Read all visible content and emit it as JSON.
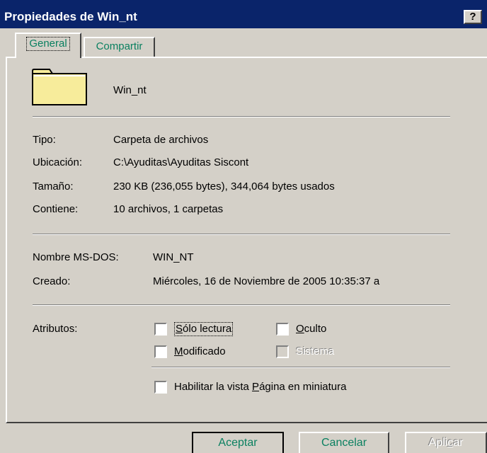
{
  "window": {
    "title": "Propiedades de Win_nt",
    "help_label": "?"
  },
  "tabs": [
    {
      "label": "General",
      "active": true
    },
    {
      "label": "Compartir",
      "active": false
    }
  ],
  "folder": {
    "name": "Win_nt",
    "icon": "folder-icon"
  },
  "info": {
    "tipo_label": "Tipo:",
    "tipo_value": "Carpeta de archivos",
    "ubicacion_label": "Ubicación:",
    "ubicacion_value": "C:\\Ayuditas\\Ayuditas Siscont",
    "tamano_label": "Tamaño:",
    "tamano_value": "230 KB (236,055 bytes), 344,064 bytes usados",
    "contiene_label": "Contiene:",
    "contiene_value": "10 archivos, 1 carpetas",
    "msdos_label": "Nombre MS-DOS:",
    "msdos_value": "WIN_NT",
    "creado_label": "Creado:",
    "creado_value": "Miércoles, 16 de Noviembre de 2005 10:35:37 a"
  },
  "attributes": {
    "label": "Atributos:",
    "solo_lectura": {
      "underlined": "S",
      "rest": "ólo lectura",
      "checked": false
    },
    "oculto": {
      "underlined": "O",
      "rest": "culto",
      "checked": false
    },
    "modificado": {
      "underlined": "M",
      "rest": "odificado",
      "checked": false
    },
    "sistema": {
      "label": "Sistema",
      "checked": false,
      "enabled": false
    },
    "miniatura": {
      "before": "Habilitar la vista ",
      "underlined": "P",
      "rest": "ágina en miniatura",
      "checked": false
    }
  },
  "buttons": {
    "aceptar": "Aceptar",
    "cancelar": "Cancelar",
    "aplicar_before": "Apli",
    "aplicar_underlined": "c",
    "aplicar_rest": "ar"
  },
  "colors": {
    "title_bar": "#0a246a",
    "face": "#d4d0c8",
    "label_accent": "#0a8060",
    "folder_fill": "#f7ec9b"
  }
}
